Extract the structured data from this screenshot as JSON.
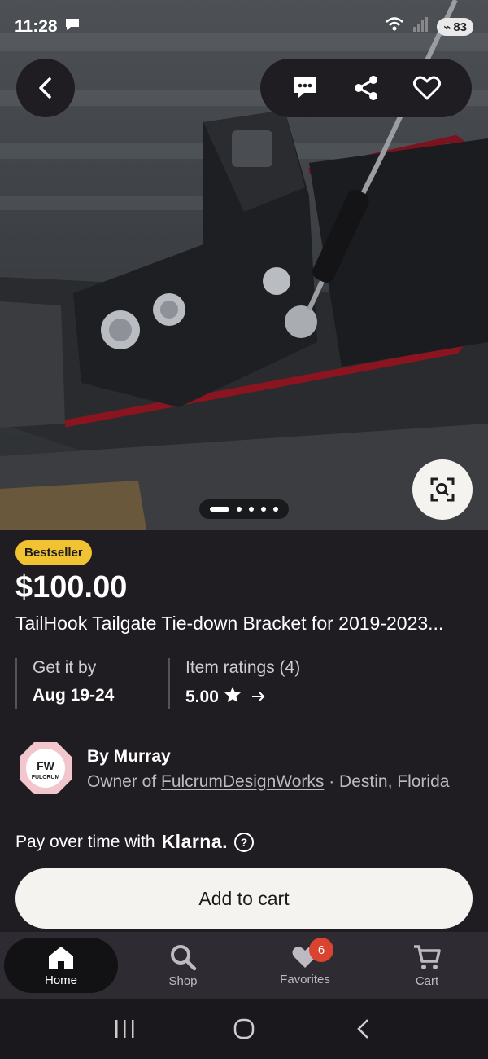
{
  "status_bar": {
    "time": "11:28",
    "wifi_label": "6",
    "battery": "83"
  },
  "product": {
    "badge": "Bestseller",
    "price": "$100.00",
    "title": "TailHook Tailgate Tie-down Bracket for 2019-2023..."
  },
  "gallery": {
    "image_count": 5,
    "active_index": 0
  },
  "delivery": {
    "label": "Get it by",
    "value": "Aug 19-24"
  },
  "ratings": {
    "label": "Item ratings (4)",
    "value": "5.00"
  },
  "seller": {
    "name": "By Murray",
    "owner_prefix": "Owner of",
    "shop": "FulcrumDesignWorks",
    "location": "· Destin, Florida",
    "logo_text": "FULCRUM",
    "logo_initials": "FW"
  },
  "klarna": {
    "text": "Pay over time with",
    "brand": "Klarna."
  },
  "cta": {
    "add_to_cart": "Add to cart"
  },
  "nav": {
    "items": [
      {
        "label": "Home",
        "icon": "home-icon",
        "active": true
      },
      {
        "label": "Shop",
        "icon": "search-icon"
      },
      {
        "label": "Favorites",
        "icon": "heart-icon",
        "badge": "6"
      },
      {
        "label": "Cart",
        "icon": "cart-icon"
      }
    ]
  },
  "colors": {
    "badge": "#f1c232",
    "background": "#1f1c22",
    "notification": "#d9432f"
  }
}
